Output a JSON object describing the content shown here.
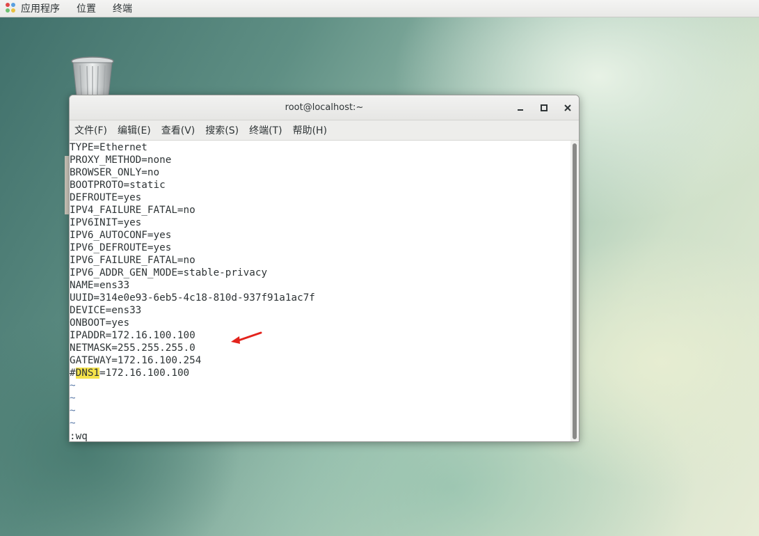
{
  "topbar": {
    "applications": "应用程序",
    "places": "位置",
    "terminal": "终端"
  },
  "window": {
    "title": "root@localhost:~",
    "controls": {
      "minimize": "‒",
      "maximize": "□",
      "close": "✕"
    }
  },
  "menu": {
    "file": "文件(F)",
    "edit": "编辑(E)",
    "view": "查看(V)",
    "search": "搜索(S)",
    "terminal": "终端(T)",
    "help": "帮助(H)"
  },
  "editor": {
    "lines": [
      "TYPE=Ethernet",
      "PROXY_METHOD=none",
      "BROWSER_ONLY=no",
      "BOOTPROTO=static",
      "DEFROUTE=yes",
      "IPV4_FAILURE_FATAL=no",
      "IPV6INIT=yes",
      "IPV6_AUTOCONF=yes",
      "IPV6_DEFROUTE=yes",
      "IPV6_FAILURE_FATAL=no",
      "IPV6_ADDR_GEN_MODE=stable-privacy",
      "NAME=ens33",
      "UUID=314e0e93-6eb5-4c18-810d-937f91a1ac7f",
      "DEVICE=ens33",
      "ONBOOT=yes",
      "IPADDR=172.16.100.100",
      "NETMASK=255.255.255.0",
      "GATEWAY=172.16.100.254"
    ],
    "dns_line": {
      "prefix": "#",
      "highlight": "DNS1",
      "rest": "=172.16.100.100"
    },
    "tilde": "~",
    "command": ":wq"
  },
  "colors": {
    "highlight": "#f5e34a",
    "arrow": "#e3231c",
    "tilde": "#5b7aa8"
  }
}
